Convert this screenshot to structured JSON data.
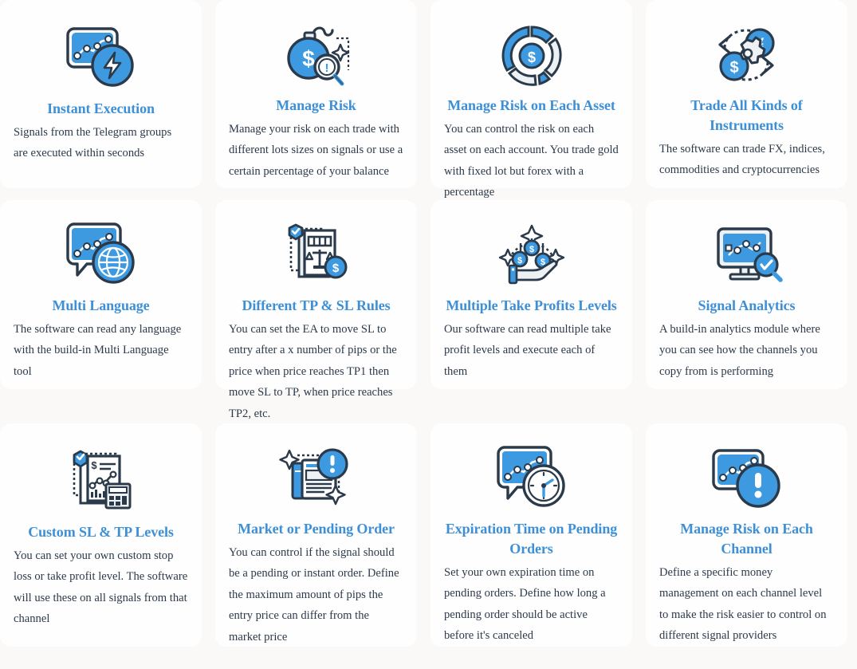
{
  "theme": {
    "page_background": "#faf9f7",
    "card_background": "#fefefe",
    "title_color": "#3d8fd6",
    "body_text_color": "#2c3a4b",
    "icon_accent_blue": "#3d9ae0",
    "icon_outline_navy": "#2b3a4a",
    "icon_light_gray": "#eef1f4"
  },
  "features": [
    {
      "icon": "chart-screen-lightning-icon",
      "title": "Instant Execution",
      "description": "Signals from the Telegram groups are executed within seconds"
    },
    {
      "icon": "money-bomb-magnifier-icon",
      "title": "Manage Risk",
      "description": "Manage your risk on each trade with different lots sizes on signals or use a certain percentage of your balance"
    },
    {
      "icon": "pie-chart-dollar-icon",
      "title": "Manage Risk on Each Asset",
      "description": "You can control the risk on each asset on each account. You trade gold with fixed lot but forex with a percentage"
    },
    {
      "icon": "currency-exchange-gear-icon",
      "title": "Trade All Kinds of Instruments",
      "description": "The software can trade FX, indices, commodities and cryptocurrencies"
    },
    {
      "icon": "chart-bubble-globe-icon",
      "title": "Multi Language",
      "description": "The software can read any language with the build-in Multi Language tool"
    },
    {
      "icon": "document-scales-coin-icon",
      "title": "Different TP & SL Rules",
      "description": "You can set the EA to move SL to entry after a x number of pips or the price when price reaches TP1 then move SL to TP, when price reaches TP2, etc."
    },
    {
      "icon": "hand-coins-sparkle-icon",
      "title": "Multiple Take Profits Levels",
      "description": "Our software can read multiple take profit levels and execute each of them"
    },
    {
      "icon": "monitor-chart-magnifier-icon",
      "title": "Signal Analytics",
      "description": "A build-in analytics module where you can see how the channels you copy from is performing"
    },
    {
      "icon": "report-calculator-shield-icon",
      "title": "Custom SL & TP Levels",
      "description": "You can set your own custom stop loss or take profit level. The software will use these on all signals from that channel"
    },
    {
      "icon": "news-document-alert-icon",
      "title": "Market or Pending Order",
      "description": "You can control if the signal should be a pending or instant order. Define the maximum amount of pips the entry price can differ from the market price"
    },
    {
      "icon": "chart-bubble-clock-icon",
      "title": "Expiration Time on Pending Orders",
      "description": "Set your own expiration time on pending orders. Define how long a pending order should be active before it's canceled"
    },
    {
      "icon": "chart-bubble-alert-icon",
      "title": "Manage Risk on Each Channel",
      "description": "Define a specific money management on each channel level to make the risk easier to control on different signal providers"
    }
  ]
}
